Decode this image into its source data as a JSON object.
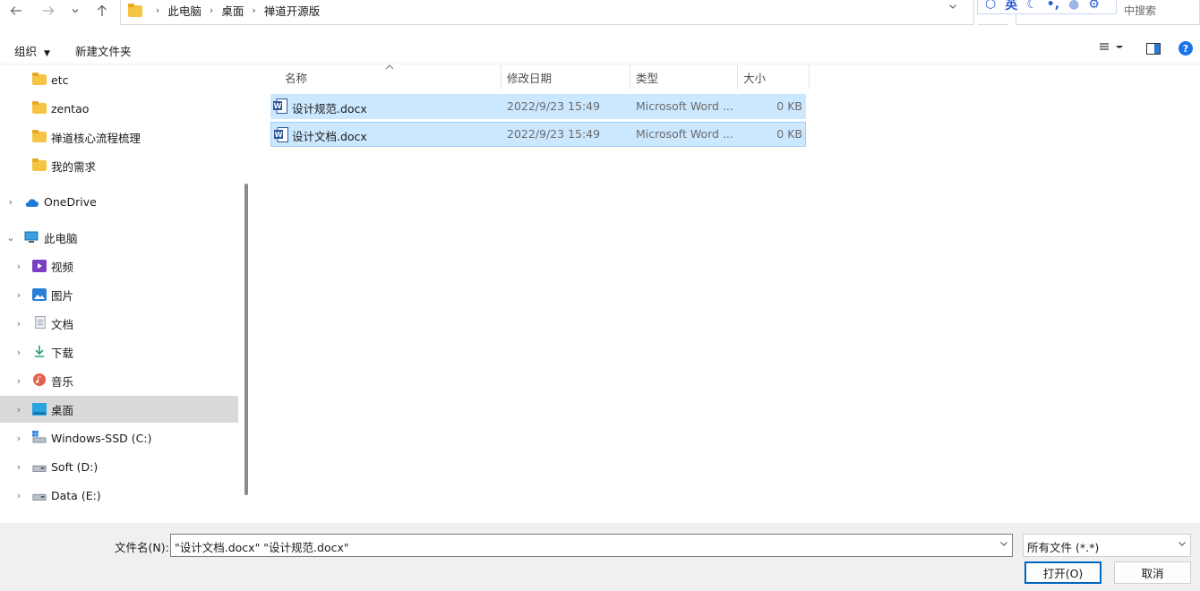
{
  "address": {
    "breadcrumbs": [
      "此电脑",
      "桌面",
      "禅道开源版"
    ]
  },
  "search": {
    "placeholder": "中搜索"
  },
  "ime": {
    "lang_label": "英"
  },
  "toolbar": {
    "organize_label": "组织",
    "new_folder_label": "新建文件夹"
  },
  "sidebar": {
    "quick_folders": [
      "etc",
      "zentao",
      "禅道核心流程梳理",
      "我的需求"
    ],
    "onedrive_label": "OneDrive",
    "this_pc_label": "此电脑",
    "pc_items": [
      {
        "label": "视频",
        "icon": "video-icon"
      },
      {
        "label": "图片",
        "icon": "pictures-icon"
      },
      {
        "label": "文档",
        "icon": "documents-icon"
      },
      {
        "label": "下载",
        "icon": "download-icon"
      },
      {
        "label": "音乐",
        "icon": "music-icon"
      },
      {
        "label": "桌面",
        "icon": "desktop-icon",
        "selected": true
      },
      {
        "label": "Windows-SSD (C:)",
        "icon": "drive-icon"
      },
      {
        "label": "Soft (D:)",
        "icon": "drive-icon"
      },
      {
        "label": "Data (E:)",
        "icon": "drive-icon"
      }
    ]
  },
  "columns": {
    "name": "名称",
    "modified": "修改日期",
    "type": "类型",
    "size": "大小"
  },
  "files": [
    {
      "name": "设计规范.docx",
      "modified": "2022/9/23 15:49",
      "type": "Microsoft Word ...",
      "size": "0 KB"
    },
    {
      "name": "设计文档.docx",
      "modified": "2022/9/23 15:49",
      "type": "Microsoft Word ...",
      "size": "0 KB"
    }
  ],
  "footer": {
    "filename_label": "文件名(N):",
    "filename_value": "\"设计文档.docx\" \"设计规范.docx\"",
    "filetype_value": "所有文件 (*.*)",
    "open_label": "打开(O)",
    "cancel_label": "取消"
  },
  "colors": {
    "selection": "#cce8ff",
    "accent": "#0067c0",
    "folder": "#f6c443"
  }
}
